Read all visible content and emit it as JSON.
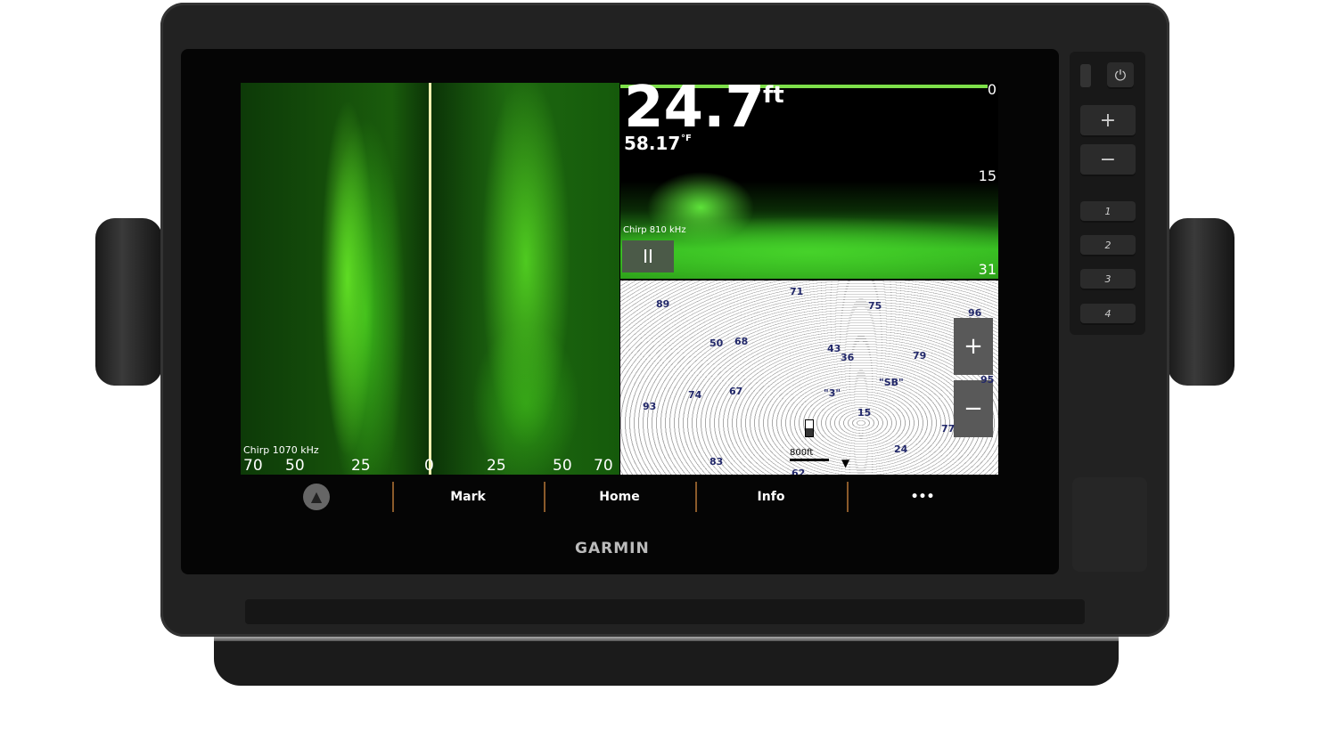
{
  "brand": "GARMIN",
  "side_view": {
    "frequency": "Chirp 1070 kHz",
    "scale": [
      "70",
      "50",
      "25",
      "0",
      "25",
      "50",
      "70"
    ]
  },
  "down_view": {
    "depth": "24.7",
    "depth_unit": "ft",
    "water_temp": "58.17",
    "temp_unit": "°F",
    "frequency": "Chirp 810 kHz",
    "range_labels": [
      "0",
      "15",
      "31"
    ],
    "pause_label": "II"
  },
  "map": {
    "depth_labels": [
      "71",
      "75",
      "89",
      "50",
      "68",
      "43",
      "36",
      "79",
      "\"SB\"",
      "74",
      "67",
      "\"3\"",
      "93",
      "15",
      "77",
      "83",
      "24",
      "62",
      "96",
      "95"
    ],
    "scale_label": "800ft",
    "zoom_in": "+",
    "zoom_out": "−"
  },
  "softkeys": {
    "nav_icon": "▲",
    "items": [
      "Mark",
      "Home",
      "Info",
      "•••"
    ]
  },
  "hardware_keys": {
    "power": "⏻",
    "plus": "+",
    "minus": "−",
    "presets": [
      "1",
      "2",
      "3",
      "4"
    ]
  },
  "colors": {
    "sonar": "#4fca20",
    "accent_divider": "#8a5a2a"
  }
}
